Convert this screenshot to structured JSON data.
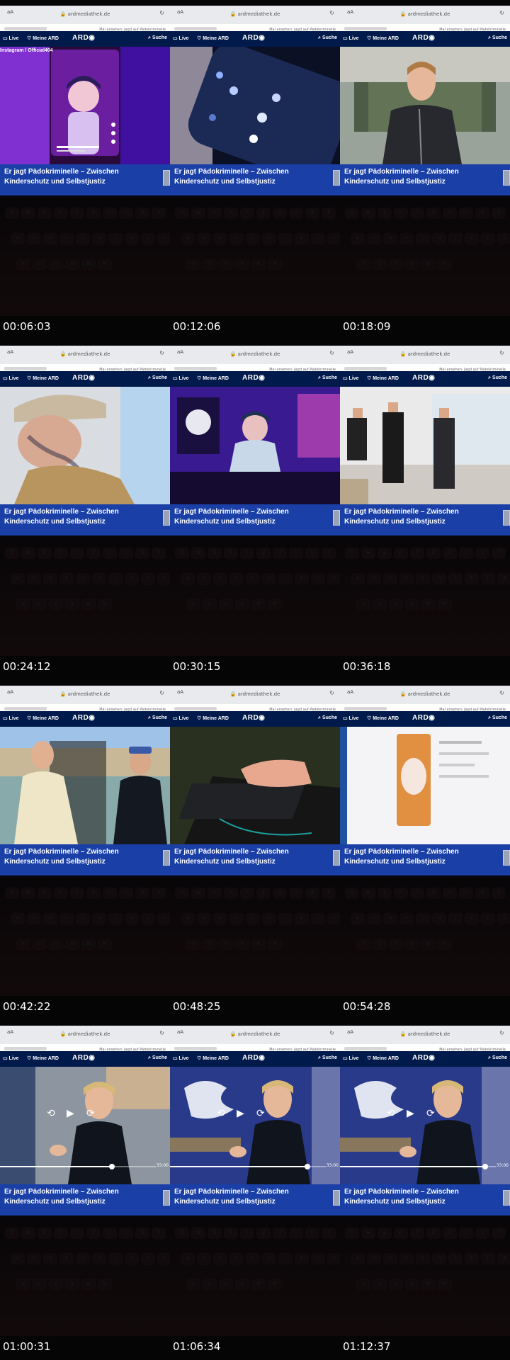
{
  "browser": {
    "text_size_label": "aA",
    "url": "ardmediathek.de",
    "subtitle_snippet": "Mal ansehen: Jagd auf Pädokriminelle"
  },
  "ard_nav": {
    "live": "Live",
    "meine_ard": "Meine ARD",
    "logo": "ARD",
    "suche": "Suche"
  },
  "page_title": "Er jagt Pädokriminelle – Zwischen Kinderschutz und Selbstjustiz",
  "instagram_caption": "Instagram / Official404",
  "video_duration": "33:00",
  "colors": {
    "nav_bg": "#001a4b",
    "title_bg": "#1a3fa6"
  },
  "frames": [
    {
      "timestamp": "00:06:03",
      "scene": "instagram"
    },
    {
      "timestamp": "00:12:06",
      "scene": "phone"
    },
    {
      "timestamp": "00:18:09",
      "scene": "man-office"
    },
    {
      "timestamp": "00:24:12",
      "scene": "tattoo-man"
    },
    {
      "timestamp": "00:30:15",
      "scene": "gamer"
    },
    {
      "timestamp": "00:36:18",
      "scene": "office-people"
    },
    {
      "timestamp": "00:42:22",
      "scene": "two-men"
    },
    {
      "timestamp": "00:48:25",
      "scene": "laptop"
    },
    {
      "timestamp": "00:54:28",
      "scene": "tablet"
    },
    {
      "timestamp": "01:00:31",
      "scene": "interview",
      "progress": 0.72
    },
    {
      "timestamp": "01:06:34",
      "scene": "interview-2",
      "progress": 0.88
    },
    {
      "timestamp": "01:12:37",
      "scene": "interview-2",
      "progress": 0.93
    }
  ]
}
